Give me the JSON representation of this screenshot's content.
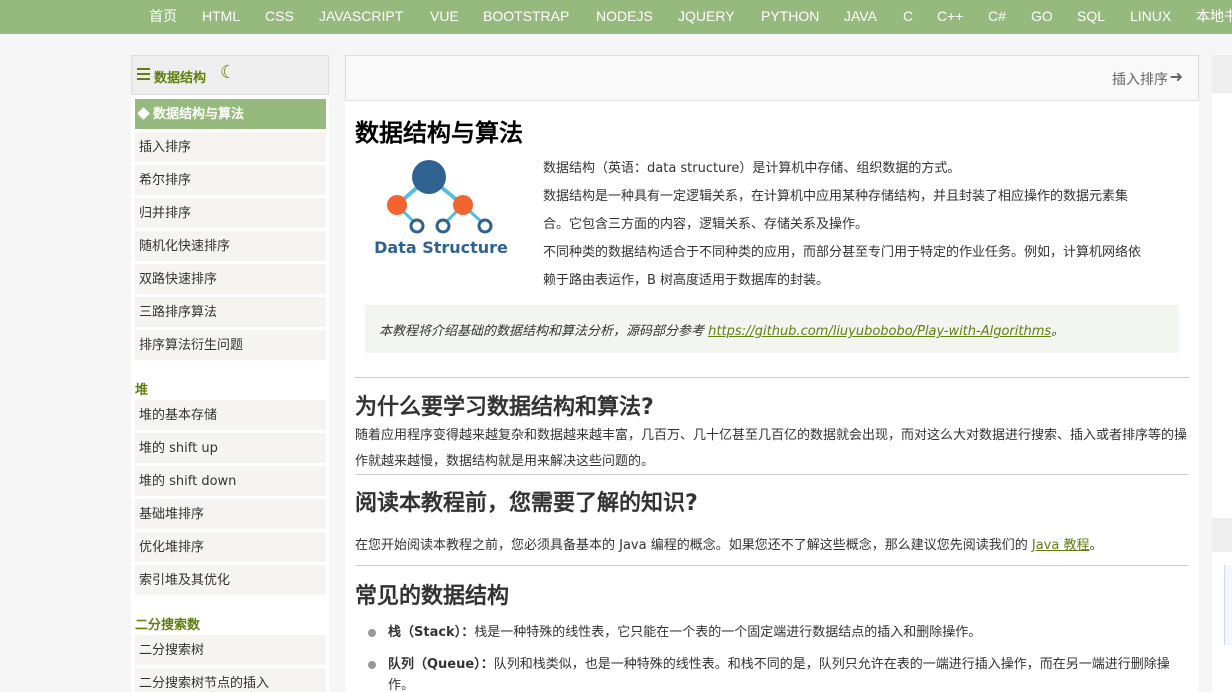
{
  "topnav": [
    "首页",
    "HTML",
    "CSS",
    "JAVASCRIPT",
    "VUE",
    "BOOTSTRAP",
    "NODEJS",
    "JQUERY",
    "PYTHON",
    "JAVA",
    "C",
    "C++",
    "C#",
    "GO",
    "SQL",
    "LINUX",
    "本地书签"
  ],
  "sidebar": {
    "title": "数据结构",
    "items": [
      {
        "label": "数据结构与算法",
        "active": true
      },
      {
        "label": "插入排序"
      },
      {
        "label": "希尔排序"
      },
      {
        "label": "归并排序"
      },
      {
        "label": "随机化快速排序"
      },
      {
        "label": "双路快速排序"
      },
      {
        "label": "三路排序算法"
      },
      {
        "label": "排序算法衍生问题"
      }
    ],
    "cat_heap": "堆",
    "heap_items": [
      "堆的基本存储",
      "堆的 shift up",
      "堆的 shift down",
      "基础堆排序",
      "优化堆排序",
      "索引堆及其优化"
    ],
    "cat_bst": "二分搜索数",
    "bst_items": [
      "二分搜索树",
      "二分搜索树节点的插入"
    ]
  },
  "main": {
    "next_label": "插入排序",
    "title": "数据结构与算法",
    "logo_text": "Data Structure",
    "intro": [
      "数据结构（英语：data structure）是计算机中存储、组织数据的方式。",
      "数据结构是一种具有一定逻辑关系，在计算机中应用某种存储结构，并且封装了相应操作的数据元素集",
      "合。它包含三方面的内容，逻辑关系、存储关系及操作。",
      "不同种类的数据结构适合于不同种类的应用，而部分甚至专门用于特定的作业任务。例如，计算机网络依",
      "赖于路由表运作，B 树高度适用于数据库的封装。"
    ],
    "tip_text": "本教程将介绍基础的数据结构和算法分析，源码部分参考 ",
    "tip_link": "https://github.com/liuyubobobo/Play-with-Algorithms",
    "tip_end": "。",
    "h_why": "为什么要学习数据结构和算法?",
    "why_p1": "随着应用程序变得越来越复杂和数据越来越丰富，几百万、几十亿甚至几百亿的数据就会出现，而对这么大对数据进行搜索、插入或者排序等的操",
    "why_p2": "作就越来越慢，数据结构就是用来解决这些问题的。",
    "h_know": "阅读本教程前，您需要了解的知识?",
    "know_text": "在您开始阅读本教程之前，您必须具备基本的 Java 编程的概念。如果您还不了解这些概念，那么建议您先阅读我们的 ",
    "know_link": "Java 教程",
    "know_end": "。",
    "h_common": "常见的数据结构",
    "list": [
      {
        "term": "栈（Stack）：",
        "desc": "栈是一种特殊的线性表，它只能在一个表的一个固定端进行数据结点的插入和删除操作。"
      },
      {
        "term": "队列（Queue）：",
        "desc": "队列和栈类似，也是一种特殊的线性表。和栈不同的是，队列只允许在表的一端进行插入操作，而在另一端进行删除操"
      },
      {
        "term": "",
        "desc": "作。"
      }
    ]
  }
}
